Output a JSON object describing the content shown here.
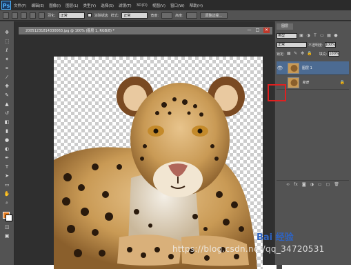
{
  "menu": {
    "logo": "Ps",
    "items": [
      "文件(F)",
      "编辑(E)",
      "图像(I)",
      "图层(L)",
      "类型(Y)",
      "选择(S)",
      "滤镜(T)",
      "3D(D)",
      "视图(V)",
      "窗口(W)",
      "帮助(H)"
    ]
  },
  "options": {
    "feather_label": "羽化:",
    "feather_value": "正常",
    "antialias_label": "消除锯齿",
    "style_label": "样式:",
    "style_value": "正常",
    "width_label": "宽度:",
    "height_label": "高度:",
    "refine_label": "调整边缘..."
  },
  "document": {
    "tab_title": "20051231814330063.jpg @ 100% (图层 1, RGB/8) *",
    "min_btn": "—",
    "max_btn": "□",
    "close_btn": "✕"
  },
  "layers_panel": {
    "tab": "图层",
    "kind_label": "类型",
    "blend_mode": "正常",
    "opacity_label": "不透明度:",
    "opacity_value": "100%",
    "lock_label": "锁定:",
    "fill_label": "填充:",
    "fill_value": "100%",
    "layers": [
      {
        "name": "图层 1",
        "visible": true,
        "selected": true
      },
      {
        "name": "背景",
        "visible": false,
        "selected": false,
        "locked": true
      }
    ],
    "footer_icons": [
      "link-icon",
      "fx-icon",
      "mask-icon",
      "adjustment-icon",
      "group-icon",
      "new-layer-icon",
      "trash-icon"
    ]
  },
  "watermark": {
    "brand": "Bai 经验",
    "url": "https://blog.csdn.net/qq_34720531"
  },
  "colors": {
    "highlight": "#e02020",
    "selection": "#4c6b92",
    "foreground_swatch": "#e67e22"
  }
}
